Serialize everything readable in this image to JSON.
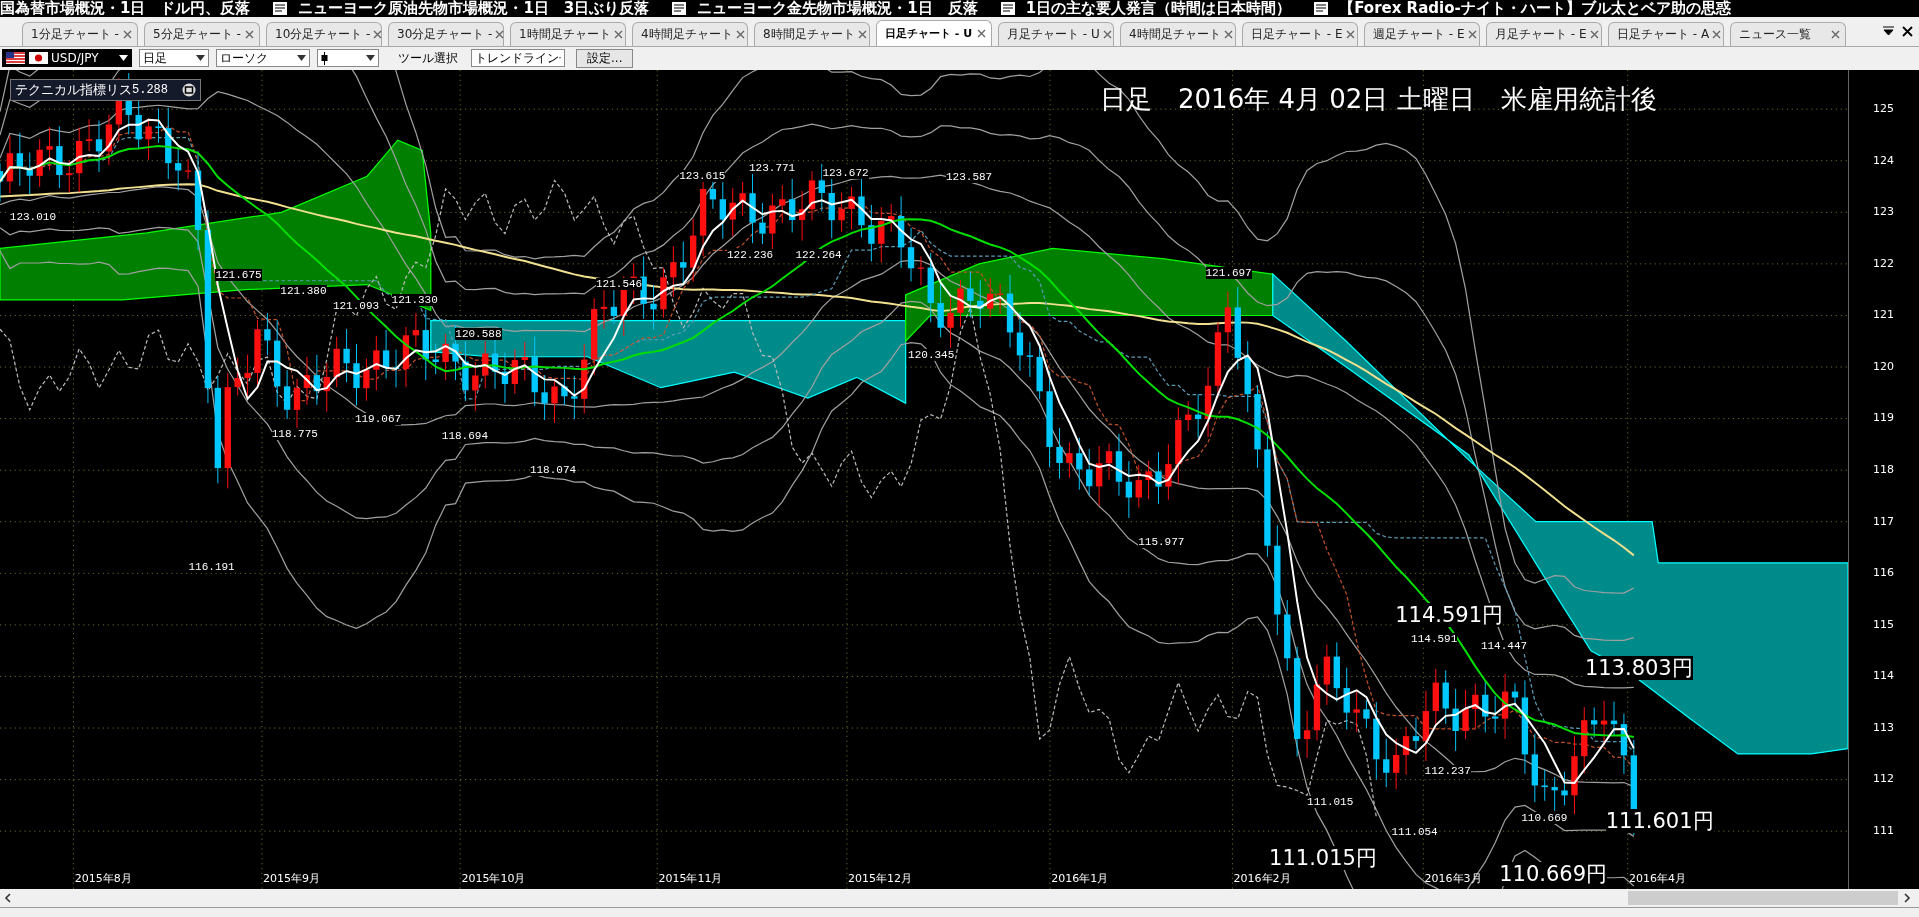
{
  "news_ticker": [
    {
      "text": "国為替市場概況・1日　ドル円、反落"
    },
    {
      "text": "ニューヨーク原油先物市場概況・1日　3日ぶり反落"
    },
    {
      "text": "ニューヨーク金先物市場概況・1日　反落"
    },
    {
      "text": "1日の主な要人発言（時間は日本時間）"
    },
    {
      "text": "【Forex Radio-ナイト・ハート】ブル太とベア助の思惑"
    }
  ],
  "tabs": [
    {
      "label": "1分足チャート -",
      "selected": false
    },
    {
      "label": "5分足チャート -",
      "selected": false
    },
    {
      "label": "10分足チャート -",
      "selected": false
    },
    {
      "label": "30分足チャート -",
      "selected": false
    },
    {
      "label": "1時間足チャート",
      "selected": false
    },
    {
      "label": "4時間足チャート",
      "selected": false
    },
    {
      "label": "8時間足チャート",
      "selected": false
    },
    {
      "label": "日足チャート - U",
      "selected": true
    },
    {
      "label": "月足チャート - U",
      "selected": false
    },
    {
      "label": "4時間足チャート",
      "selected": false
    },
    {
      "label": "日足チャート - E",
      "selected": false
    },
    {
      "label": "週足チャート - E",
      "selected": false
    },
    {
      "label": "月足チャート - E",
      "selected": false
    },
    {
      "label": "日足チャート - A",
      "selected": false
    },
    {
      "label": "ニュース一覧",
      "selected": false
    }
  ],
  "toolbar": {
    "symbol": "USD/JPY",
    "timeframe": "日足",
    "chart_type": "ローソク",
    "tool_label": "ツール選択",
    "tool": "トレンドライン",
    "settings_button": "設定..."
  },
  "chart": {
    "title": "日足　2016年 4月 02日 土曜日　米雇用統計後",
    "indicator_panel": "テクニカル指標リス",
    "covered_price_label": "5.288",
    "price_labels": [
      "123.010",
      "121.675",
      "121.380",
      "121.093",
      "121.330",
      "120.588",
      "121.546",
      "123.615",
      "123.771",
      "122.236",
      "122.264",
      "123.672",
      "123.587",
      "121.697",
      "120.345",
      "118.775",
      "119.067",
      "118.694",
      "118.074",
      "116.191",
      "115.977",
      "114.591",
      "114.447",
      "112.237",
      "111.015",
      "111.054",
      "110.669"
    ],
    "callouts": [
      "114.591円",
      "113.803円",
      "111.601円",
      "111.015円",
      "110.669円"
    ],
    "price_axis": [
      "125",
      "124",
      "123",
      "122",
      "121",
      "120",
      "119",
      "118",
      "117",
      "116",
      "115",
      "114",
      "113",
      "112",
      "111"
    ],
    "date_axis": [
      "2015年8月",
      "2015年9月",
      "2015年10月",
      "2015年11月",
      "2015年12月",
      "2016年1月",
      "2016年2月",
      "2016年3月",
      "2016年4月"
    ]
  }
}
